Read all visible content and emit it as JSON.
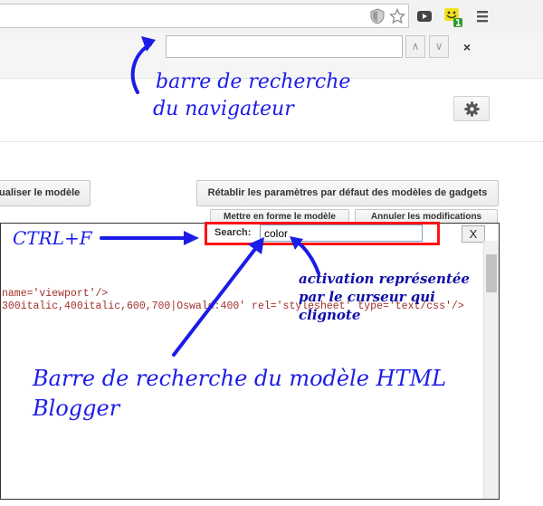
{
  "browser": {
    "find_bar": {
      "value": "",
      "placeholder": "",
      "prev": "∧",
      "next": "∨",
      "close": "×"
    }
  },
  "page": {
    "buttons": {
      "preview": "ualiser le modèle",
      "reset": "Rétablir les paramètres par défaut des modèles de gadgets",
      "format": "Mettre en forme le modèle",
      "cancel": "Annuler les modifications"
    }
  },
  "editor": {
    "search_label": "Search:",
    "search_value": "color",
    "close": "X",
    "code_lines": [
      "name='viewport'/>",
      "300italic,400italic,600,700|Oswald:400' rel='stylesheet' type='text/css'/>"
    ]
  },
  "annotations": {
    "browser_search": [
      "barre de recherche",
      "du navigateur"
    ],
    "ctrlf": "CTRL+F",
    "activation": [
      "activation représentée",
      "par le curseur qui",
      "clignote"
    ],
    "blogger_search": [
      "Barre de recherche du  modèle HTML",
      "Blogger"
    ]
  },
  "colors": {
    "annotation_blue": "#1c1ce8",
    "highlight_red": "#ff1111"
  }
}
